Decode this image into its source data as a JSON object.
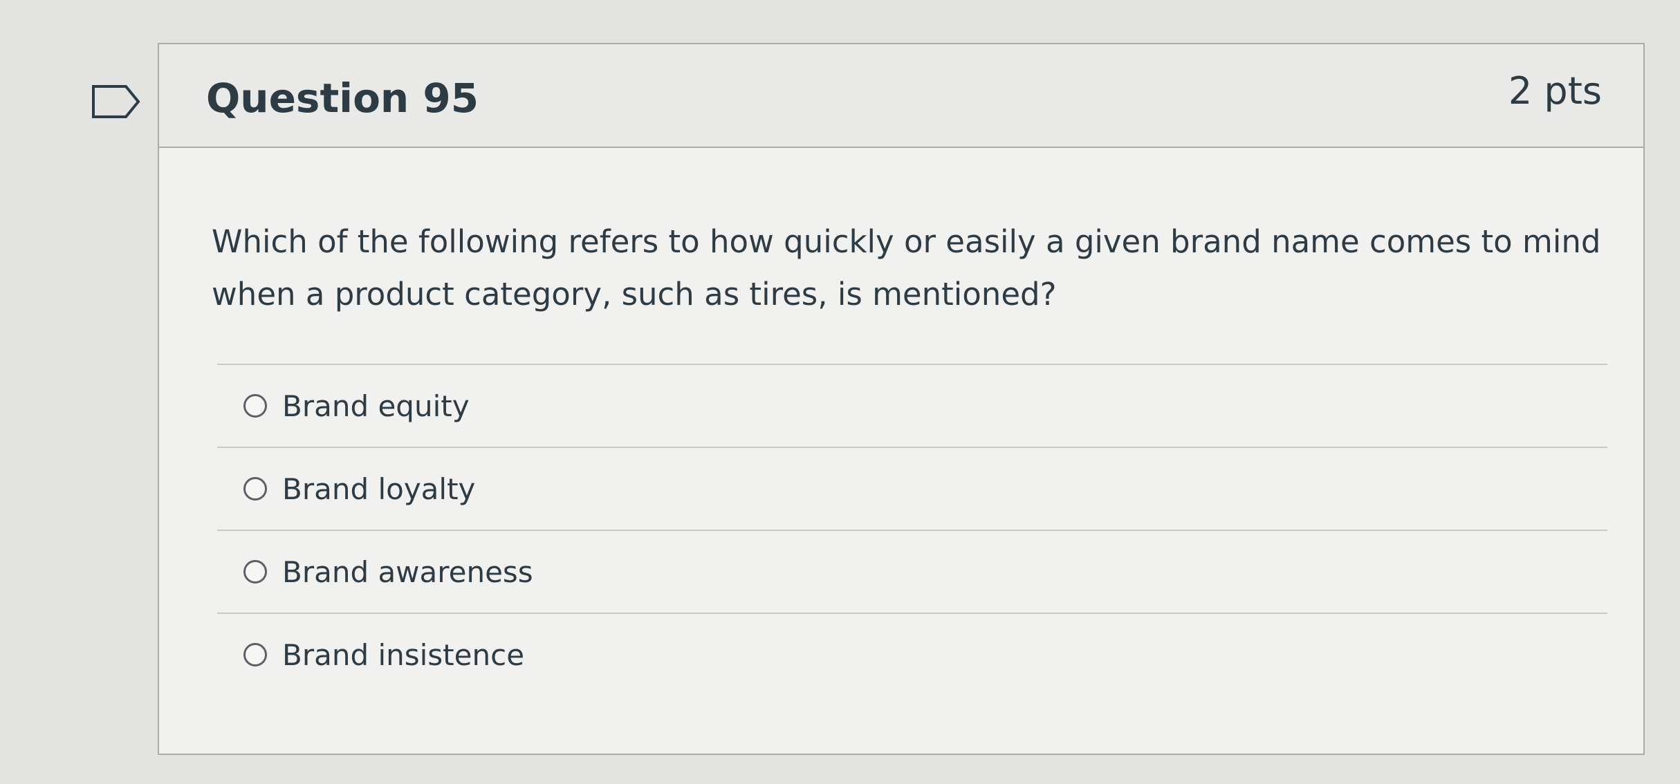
{
  "question": {
    "title": "Question 95",
    "points": "2 pts",
    "text": "Which of the following refers to how quickly or easily a given brand name comes to mind when a product category, such as tires, is mentioned?"
  },
  "answers": [
    {
      "label": "Brand equity",
      "selected": false
    },
    {
      "label": "Brand loyalty",
      "selected": false
    },
    {
      "label": "Brand awareness",
      "selected": false
    },
    {
      "label": "Brand insistence",
      "selected": false
    }
  ],
  "icons": {
    "flag": "flag-icon"
  },
  "colors": {
    "background": "#e3e3e1",
    "card": "#f1f1ef",
    "header": "#e9e9e7",
    "border": "#a9aca9",
    "text": "#2d3b45"
  }
}
